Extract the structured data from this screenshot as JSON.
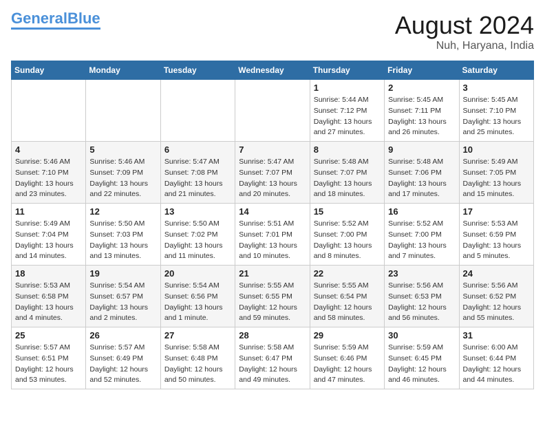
{
  "logo": {
    "part1": "General",
    "part2": "Blue"
  },
  "title": "August 2024",
  "location": "Nuh, Haryana, India",
  "days_of_week": [
    "Sunday",
    "Monday",
    "Tuesday",
    "Wednesday",
    "Thursday",
    "Friday",
    "Saturday"
  ],
  "weeks": [
    [
      {
        "num": "",
        "info": ""
      },
      {
        "num": "",
        "info": ""
      },
      {
        "num": "",
        "info": ""
      },
      {
        "num": "",
        "info": ""
      },
      {
        "num": "1",
        "info": "Sunrise: 5:44 AM\nSunset: 7:12 PM\nDaylight: 13 hours\nand 27 minutes."
      },
      {
        "num": "2",
        "info": "Sunrise: 5:45 AM\nSunset: 7:11 PM\nDaylight: 13 hours\nand 26 minutes."
      },
      {
        "num": "3",
        "info": "Sunrise: 5:45 AM\nSunset: 7:10 PM\nDaylight: 13 hours\nand 25 minutes."
      }
    ],
    [
      {
        "num": "4",
        "info": "Sunrise: 5:46 AM\nSunset: 7:10 PM\nDaylight: 13 hours\nand 23 minutes."
      },
      {
        "num": "5",
        "info": "Sunrise: 5:46 AM\nSunset: 7:09 PM\nDaylight: 13 hours\nand 22 minutes."
      },
      {
        "num": "6",
        "info": "Sunrise: 5:47 AM\nSunset: 7:08 PM\nDaylight: 13 hours\nand 21 minutes."
      },
      {
        "num": "7",
        "info": "Sunrise: 5:47 AM\nSunset: 7:07 PM\nDaylight: 13 hours\nand 20 minutes."
      },
      {
        "num": "8",
        "info": "Sunrise: 5:48 AM\nSunset: 7:07 PM\nDaylight: 13 hours\nand 18 minutes."
      },
      {
        "num": "9",
        "info": "Sunrise: 5:48 AM\nSunset: 7:06 PM\nDaylight: 13 hours\nand 17 minutes."
      },
      {
        "num": "10",
        "info": "Sunrise: 5:49 AM\nSunset: 7:05 PM\nDaylight: 13 hours\nand 15 minutes."
      }
    ],
    [
      {
        "num": "11",
        "info": "Sunrise: 5:49 AM\nSunset: 7:04 PM\nDaylight: 13 hours\nand 14 minutes."
      },
      {
        "num": "12",
        "info": "Sunrise: 5:50 AM\nSunset: 7:03 PM\nDaylight: 13 hours\nand 13 minutes."
      },
      {
        "num": "13",
        "info": "Sunrise: 5:50 AM\nSunset: 7:02 PM\nDaylight: 13 hours\nand 11 minutes."
      },
      {
        "num": "14",
        "info": "Sunrise: 5:51 AM\nSunset: 7:01 PM\nDaylight: 13 hours\nand 10 minutes."
      },
      {
        "num": "15",
        "info": "Sunrise: 5:52 AM\nSunset: 7:00 PM\nDaylight: 13 hours\nand 8 minutes."
      },
      {
        "num": "16",
        "info": "Sunrise: 5:52 AM\nSunset: 7:00 PM\nDaylight: 13 hours\nand 7 minutes."
      },
      {
        "num": "17",
        "info": "Sunrise: 5:53 AM\nSunset: 6:59 PM\nDaylight: 13 hours\nand 5 minutes."
      }
    ],
    [
      {
        "num": "18",
        "info": "Sunrise: 5:53 AM\nSunset: 6:58 PM\nDaylight: 13 hours\nand 4 minutes."
      },
      {
        "num": "19",
        "info": "Sunrise: 5:54 AM\nSunset: 6:57 PM\nDaylight: 13 hours\nand 2 minutes."
      },
      {
        "num": "20",
        "info": "Sunrise: 5:54 AM\nSunset: 6:56 PM\nDaylight: 13 hours\nand 1 minute."
      },
      {
        "num": "21",
        "info": "Sunrise: 5:55 AM\nSunset: 6:55 PM\nDaylight: 12 hours\nand 59 minutes."
      },
      {
        "num": "22",
        "info": "Sunrise: 5:55 AM\nSunset: 6:54 PM\nDaylight: 12 hours\nand 58 minutes."
      },
      {
        "num": "23",
        "info": "Sunrise: 5:56 AM\nSunset: 6:53 PM\nDaylight: 12 hours\nand 56 minutes."
      },
      {
        "num": "24",
        "info": "Sunrise: 5:56 AM\nSunset: 6:52 PM\nDaylight: 12 hours\nand 55 minutes."
      }
    ],
    [
      {
        "num": "25",
        "info": "Sunrise: 5:57 AM\nSunset: 6:51 PM\nDaylight: 12 hours\nand 53 minutes."
      },
      {
        "num": "26",
        "info": "Sunrise: 5:57 AM\nSunset: 6:49 PM\nDaylight: 12 hours\nand 52 minutes."
      },
      {
        "num": "27",
        "info": "Sunrise: 5:58 AM\nSunset: 6:48 PM\nDaylight: 12 hours\nand 50 minutes."
      },
      {
        "num": "28",
        "info": "Sunrise: 5:58 AM\nSunset: 6:47 PM\nDaylight: 12 hours\nand 49 minutes."
      },
      {
        "num": "29",
        "info": "Sunrise: 5:59 AM\nSunset: 6:46 PM\nDaylight: 12 hours\nand 47 minutes."
      },
      {
        "num": "30",
        "info": "Sunrise: 5:59 AM\nSunset: 6:45 PM\nDaylight: 12 hours\nand 46 minutes."
      },
      {
        "num": "31",
        "info": "Sunrise: 6:00 AM\nSunset: 6:44 PM\nDaylight: 12 hours\nand 44 minutes."
      }
    ]
  ]
}
